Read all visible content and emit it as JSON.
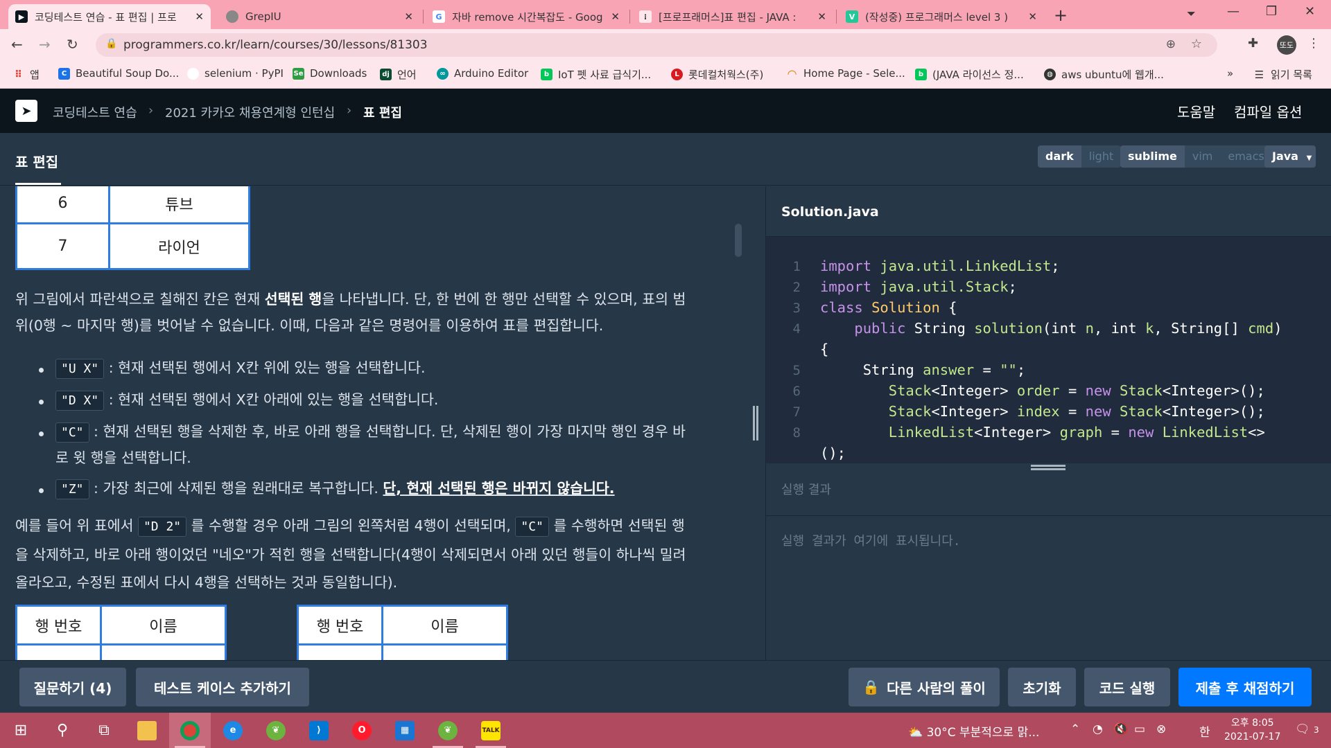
{
  "browser": {
    "tabs": [
      {
        "title": "코딩테스트 연습 - 표 편집 | 프로",
        "active": true
      },
      {
        "title": "GrepIU",
        "active": false
      },
      {
        "title": "자바 remove 시간복잡도 - Goog",
        "active": false
      },
      {
        "title": "[프로프래머스]표 편집 - JAVA :",
        "active": false
      },
      {
        "title": "(작성중) 프로그래머스 level 3 )",
        "active": false
      }
    ],
    "url": "programmers.co.kr/learn/courses/30/lessons/81303",
    "profile": "또도",
    "bookmarks": [
      "앱",
      "Beautiful Soup Do...",
      "selenium · PyPI",
      "Downloads",
      "언어",
      "Arduino Editor",
      "IoT 펫 사료 급식기...",
      "롯데컬처웍스(주)",
      "Home Page - Sele...",
      "(JAVA 라이선스 정...",
      "aws ubuntu에 웹개..."
    ],
    "bookmarks_more": "»",
    "reading_list": "읽기 목록"
  },
  "header": {
    "breadcrumb": [
      "코딩테스트 연습",
      "2021 카카오 채용연계형 인턴십",
      "표 편집"
    ],
    "help": "도움말",
    "compile_options": "컴파일 옵션"
  },
  "challenge": {
    "title": "표 편집",
    "theme_options": [
      "dark",
      "light"
    ],
    "keymap_options": [
      "sublime",
      "vim",
      "emacs"
    ],
    "language": "Java"
  },
  "description": {
    "top_table": [
      [
        "6",
        "튜브"
      ],
      [
        "7",
        "라이언"
      ]
    ],
    "para1_a": "위 그림에서 파란색으로 칠해진 칸은 현재 ",
    "para1_bold": "선택된 행",
    "para1_b": "을 나타냅니다. 단, 한 번에 한 행만 선택할 수 있으며, 표의 범",
    "para1_line2": "위(0행 ~ 마지막 행)를 벗어날 수 없습니다. 이때, 다음과 같은 명령어를 이용하여 표를 편집합니다.",
    "bullets": [
      {
        "code": "\"U X\"",
        "text": " : 현재 선택된 행에서 X칸 위에 있는 행을 선택합니다."
      },
      {
        "code": "\"D X\"",
        "text": " : 현재 선택된 행에서 X칸 아래에 있는 행을 선택합니다."
      },
      {
        "code": "\"C\"",
        "text": " : 현재 선택된 행을 삭제한 후, 바로 아래 행을 선택합니다. 단, 삭제된 행이 가장 마지막 행인 경우 바",
        "line2": "로 윗 행을 선택합니다."
      },
      {
        "code": "\"Z\"",
        "text": " : 가장 최근에 삭제된 행을 원래대로 복구합니다. ",
        "emph": "단, 현재 선택된 행은 바뀌지 않습니다."
      }
    ],
    "para2_a": "예를 들어 위 표에서 ",
    "para2_code1": "\"D 2\"",
    "para2_b": " 를 수행할 경우 아래 그림의 왼쪽처럼 4행이 선택되며, ",
    "para2_code2": "\"C\"",
    "para2_c": " 를 수행하면 선택된 행",
    "para2_line2": "을 삭제하고, 바로 아래 행이었던 \"네오\"가 적힌 행을 선택합니다(4행이 삭제되면서 아래 있던 행들이 하나씩 밀려",
    "para2_line3": "올라오고, 수정된 표에서 다시 4행을 선택하는 것과 동일합니다).",
    "bottom_table_headers": [
      "행 번호",
      "이름"
    ]
  },
  "editor": {
    "filename": "Solution.java",
    "line_numbers": [
      "1",
      "2",
      "3",
      "4",
      "",
      "5",
      "6",
      "7",
      "8",
      ""
    ],
    "result_title": "실행 결과",
    "result_placeholder": "실행 결과가 여기에 표시됩니다."
  },
  "actions": {
    "ask": "질문하기 (4)",
    "add_testcase": "테스트 케이스 추가하기",
    "others_solution": "다른 사람의 풀이",
    "reset": "초기화",
    "run": "코드 실행",
    "submit": "제출 후 채점하기"
  },
  "taskbar": {
    "weather": "30°C  부분적으로 맑...",
    "ime": "한",
    "time": "오후 8:05",
    "date": "2021-07-17",
    "notifications": "3"
  },
  "colors": {
    "tab_strip": "#f8a4b4",
    "page_bg": "#263747",
    "header_bg": "#0c151c",
    "editor_bg": "#202b3d",
    "submit": "#0078ff",
    "taskbar": "#b04a5e",
    "table_border": "#2f7de1"
  }
}
